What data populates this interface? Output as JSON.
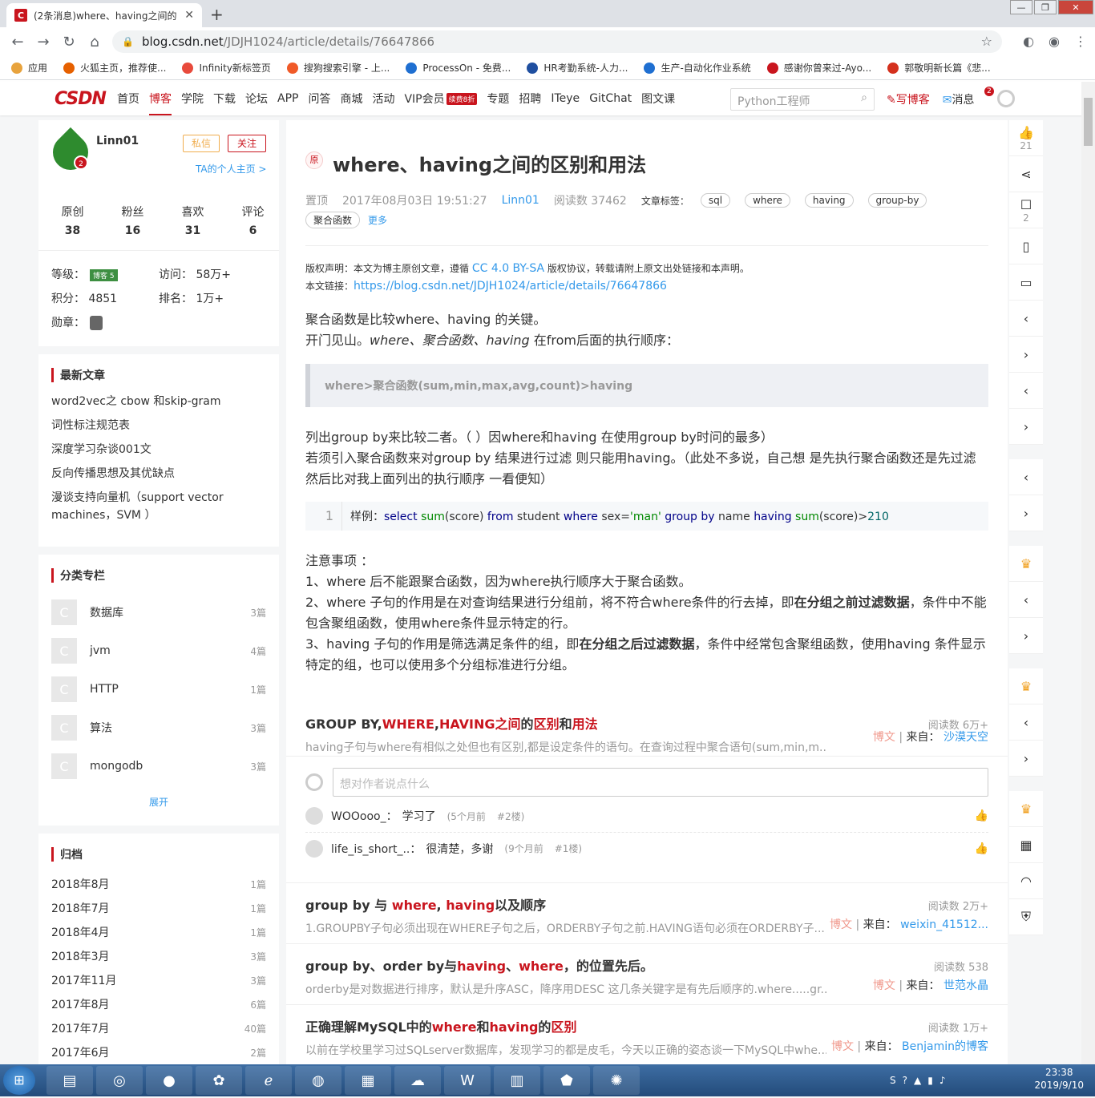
{
  "browser": {
    "tab_title": "(2条消息)where、having之间的",
    "tab_favicon": "C",
    "url_host": "blog.csdn.net",
    "url_path": "/JDJH1024/article/details/76647866",
    "bookmarks": [
      {
        "label": "应用",
        "color": "#e8a33d"
      },
      {
        "label": "火狐主页，推荐使...",
        "color": "#e66000"
      },
      {
        "label": "Infinity新标签页",
        "color": "#e84a3c"
      },
      {
        "label": "搜狗搜索引擎 - 上...",
        "color": "#f05a28"
      },
      {
        "label": "ProcessOn - 免费...",
        "color": "#1f6fd1"
      },
      {
        "label": "HR考勤系统-人力...",
        "color": "#1f4fa0"
      },
      {
        "label": "生产-自动化作业系统",
        "color": "#1f6fd1"
      },
      {
        "label": "感谢你曾来过-Ayo...",
        "color": "#c9151e"
      },
      {
        "label": "郭敬明新长篇《悲...",
        "color": "#d4301d"
      }
    ]
  },
  "csdn_nav": {
    "logo": "CSDN",
    "items": [
      "首页",
      "博客",
      "学院",
      "下载",
      "论坛",
      "APP",
      "问答",
      "商城",
      "活动",
      "VIP会员",
      "专题",
      "招聘",
      "ITeye",
      "GitChat",
      "图文课"
    ],
    "vip_badge": "续费8折",
    "search_placeholder": "Python工程师",
    "write": "写博客",
    "messages": "消息",
    "msg_count": "2"
  },
  "profile": {
    "name": "Linn01",
    "level_badge": "2",
    "pm_btn": "私信",
    "follow_btn": "关注",
    "homepage": "TA的个人主页 >",
    "stats": [
      {
        "label": "原创",
        "value": "38"
      },
      {
        "label": "粉丝",
        "value": "16"
      },
      {
        "label": "喜欢",
        "value": "31"
      },
      {
        "label": "评论",
        "value": "6"
      }
    ],
    "grade_label": "等级：",
    "grade_badge": "博客 5",
    "visits_label": "访问：",
    "visits": "58万+",
    "points_label": "积分：",
    "points": "4851",
    "rank_label": "排名：",
    "rank": "1万+",
    "medal_label": "勋章："
  },
  "recent": {
    "title": "最新文章",
    "items": [
      "word2vec之 cbow 和skip-gram",
      "词性标注规范表",
      "深度学习杂谈001文",
      "反向传播思想及其优缺点",
      "漫谈支持向量机（support vector machines，SVM ）"
    ]
  },
  "categories": {
    "title": "分类专栏",
    "items": [
      {
        "name": "数据库",
        "count": "3篇"
      },
      {
        "name": "jvm",
        "count": "4篇"
      },
      {
        "name": "HTTP",
        "count": "1篇"
      },
      {
        "name": "算法",
        "count": "3篇"
      },
      {
        "name": "mongodb",
        "count": "3篇"
      }
    ],
    "expand": "展开"
  },
  "archive": {
    "title": "归档",
    "items": [
      {
        "month": "2018年8月",
        "count": "1篇"
      },
      {
        "month": "2018年7月",
        "count": "1篇"
      },
      {
        "month": "2018年4月",
        "count": "1篇"
      },
      {
        "month": "2018年3月",
        "count": "3篇"
      },
      {
        "month": "2017年11月",
        "count": "3篇"
      },
      {
        "month": "2017年8月",
        "count": "6篇"
      },
      {
        "month": "2017年7月",
        "count": "40篇"
      },
      {
        "month": "2017年6月",
        "count": "2篇"
      }
    ]
  },
  "article": {
    "orig": "原",
    "title": "where、having之间的区别和用法",
    "pinned": "置顶",
    "date": "2017年08月03日 19:51:27",
    "author": "Linn01",
    "reads": "阅读数 37462",
    "tags_label": "文章标签：",
    "tags": [
      "sql",
      "where",
      "having",
      "group-by",
      "聚合函数"
    ],
    "more": "更多",
    "copyright_prefix": "版权声明：本文为博主原创文章，遵循",
    "copyright_license": "CC 4.0 BY-SA",
    "copyright_suffix": "版权协议，转载请附上原文出处链接和本声明。",
    "link_label": "本文链接：",
    "link": "https://blog.csdn.net/JDJH1024/article/details/76647866",
    "p1": "聚合函数是比较where、having 的关键。",
    "p2_prefix": "开门见山。",
    "p2_em": "where、聚合函数、having",
    "p2_suffix": " 在from后面的执行顺序：",
    "quote": "where>聚合函数(sum,min,max,avg,count)>having",
    "p3": "列出group by来比较二者。（ ）因where和having 在使用group by时问的最多）",
    "p4": "若须引入聚合函数来对group by 结果进行过滤 则只能用having。（此处不多说，自己想 是先执行聚合函数还是先过滤 然后比对我上面列出的执行顺序 一看便知）",
    "code_line": "1",
    "notes_title": "注意事项 ：",
    "note1": "1、where 后不能跟聚合函数，因为where执行顺序大于聚合函数。",
    "note2_a": "2、where 子句的作用是在对查询结果进行分组前，将不符合where条件的行去掉，即",
    "note2_b": "在分组之前过滤数据",
    "note2_c": "，条件中不能包含聚组函数，使用where条件显示特定的行。",
    "note3_a": "3、having 子句的作用是筛选满足条件的组，即",
    "note3_b": "在分组之后过滤数据",
    "note3_c": "，条件中经常包含聚组函数，使用having 条件显示特定的组，也可以使用多个分组标准进行分组。"
  },
  "recs": [
    {
      "t1": "GROUP BY,",
      "h1": "WHERE",
      "t2": ",",
      "h2": "HAVING之间",
      "t3": "的",
      "h3": "区别",
      "t4": "和",
      "h4": "用法",
      "t5": "",
      "reads": "阅读数 6万+",
      "desc": "having子句与where有相似之处但也有区别,都是设定条件的语句。在查询过程中聚合语句(sum,min,m...",
      "bw": "博文",
      "from": "来自：",
      "src": "沙漠天空"
    },
    {
      "t1": "group by 与 ",
      "h1": "where",
      "t2": ", ",
      "h2": "having",
      "t3": "以及顺序",
      "h3": "",
      "t4": "",
      "h4": "",
      "t5": "",
      "reads": "阅读数 2万+",
      "desc": "1.GROUPBY子句必须出现在WHERE子句之后，ORDERBY子句之前.HAVING语句必须在ORDERBY子...",
      "bw": "博文",
      "from": "来自：",
      "src": "weixin_41512..."
    },
    {
      "t1": "group by、order by与",
      "h1": "having",
      "t2": "、",
      "h2": "where",
      "t3": "，的位置先后。",
      "h3": "",
      "t4": "",
      "h4": "",
      "t5": "",
      "reads": "阅读数 538",
      "desc": "orderby是对数据进行排序，默认是升序ASC，降序用DESC 这几条关键字是有先后顺序的.where.....gr...",
      "bw": "博文",
      "from": "来自：",
      "src": "世范水晶"
    },
    {
      "t1": "正确理解MySQL中的",
      "h1": "where",
      "t2": "和",
      "h2": "having",
      "t3": "的",
      "h3": "区别",
      "t4": "",
      "h4": "",
      "t5": "",
      "reads": "阅读数 1万+",
      "desc": "以前在学校里学习过SQLserver数据库，发现学习的都是皮毛，今天以正确的姿态谈一下MySQL中whe...",
      "bw": "博文",
      "from": "来自：",
      "src": "Benjamin的博客"
    }
  ],
  "comments": {
    "placeholder": "想对作者说点什么",
    "items": [
      {
        "who": "WOOooo_：",
        "text": "学习了",
        "time": "(5个月前",
        "floor": "#2楼)"
      },
      {
        "who": "life_is_short_..：",
        "text": "很清楚，多谢",
        "time": "(9个月前",
        "floor": "#1楼)"
      }
    ]
  },
  "rightbar": {
    "likes": "21",
    "comments": "2"
  },
  "taskbar": {
    "time": "23:38",
    "date": "2019/9/10"
  }
}
